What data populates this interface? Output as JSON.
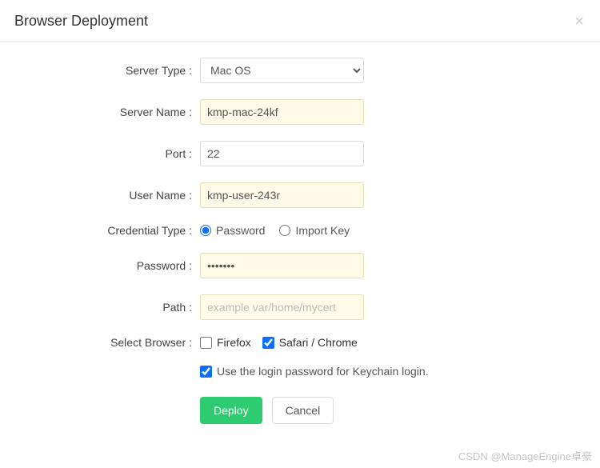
{
  "header": {
    "title": "Browser Deployment"
  },
  "form": {
    "serverType": {
      "label": "Server Type :",
      "value": "Mac OS"
    },
    "serverName": {
      "label": "Server Name :",
      "value": "kmp-mac-24kf"
    },
    "port": {
      "label": "Port :",
      "value": "22"
    },
    "userName": {
      "label": "User Name :",
      "value": "kmp-user-243r"
    },
    "credentialType": {
      "label": "Credential Type :",
      "options": {
        "password": "Password",
        "importKey": "Import Key"
      },
      "selected": "password"
    },
    "password": {
      "label": "Password :",
      "value": "•••••••"
    },
    "path": {
      "label": "Path :",
      "placeholder": "example var/home/mycert",
      "value": ""
    },
    "selectBrowser": {
      "label": "Select Browser :",
      "options": {
        "firefox": {
          "label": "Firefox",
          "checked": false
        },
        "safariChrome": {
          "label": "Safari / Chrome",
          "checked": true
        }
      }
    },
    "keychainLogin": {
      "label": "Use the login password for Keychain login.",
      "checked": true
    },
    "buttons": {
      "deploy": "Deploy",
      "cancel": "Cancel"
    }
  },
  "watermark": "CSDN @ManageEngine卓豪"
}
